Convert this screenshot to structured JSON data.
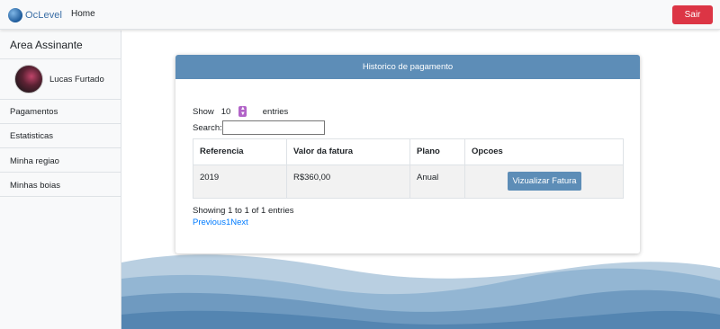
{
  "navbar": {
    "brand": "OcLevel",
    "home": "Home",
    "logout": "Sair"
  },
  "sidebar": {
    "title": "Area Assinante",
    "user_name": "Lucas Furtado",
    "items": [
      {
        "label": "Pagamentos"
      },
      {
        "label": "Estatisticas"
      },
      {
        "label": "Minha regiao"
      },
      {
        "label": "Minhas boias"
      }
    ]
  },
  "card": {
    "title": "Historico de pagamento",
    "show_label": "Show",
    "entries_value": "10",
    "entries_label": "entries",
    "search_label": "Search:",
    "search_value": "",
    "columns": [
      "Referencia",
      "Valor da fatura",
      "Plano",
      "Opcoes"
    ],
    "rows": [
      {
        "referencia": "2019",
        "valor": "R$360,00",
        "plano": "Anual",
        "action": "Vizualizar Fatura"
      }
    ],
    "info": "Showing 1 to 1 of 1 entries",
    "paging": {
      "previous": "Previous",
      "page": "1",
      "next": "Next"
    }
  },
  "colors": {
    "accent": "#5d8db7",
    "danger": "#dc3545",
    "link": "#007bff"
  }
}
